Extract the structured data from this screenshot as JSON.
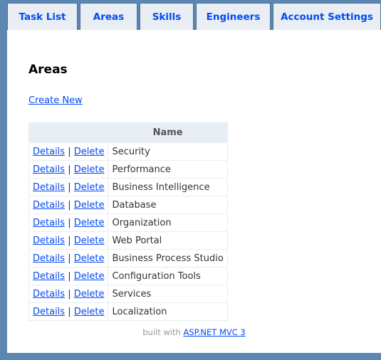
{
  "nav": {
    "tabs": [
      {
        "label": "Task List"
      },
      {
        "label": "Areas"
      },
      {
        "label": "Skills"
      },
      {
        "label": "Engineers"
      },
      {
        "label": "Account Settings"
      }
    ]
  },
  "page": {
    "title": "Areas",
    "create_link": "Create New"
  },
  "table": {
    "header_actions": "",
    "header_name": "Name",
    "details_label": "Details",
    "separator": "|",
    "delete_label": "Delete",
    "rows": [
      {
        "name": "Security"
      },
      {
        "name": "Performance"
      },
      {
        "name": "Business Intelligence"
      },
      {
        "name": "Database"
      },
      {
        "name": "Organization"
      },
      {
        "name": "Web Portal"
      },
      {
        "name": "Business Process Studio"
      },
      {
        "name": "Configuration Tools"
      },
      {
        "name": "Services"
      },
      {
        "name": "Localization"
      }
    ]
  },
  "footer": {
    "text": "built with",
    "link": "ASP.NET MVC 3"
  },
  "colors": {
    "background": "#5c87b2",
    "tab_background": "#e8eef4",
    "link": "#034af3"
  }
}
